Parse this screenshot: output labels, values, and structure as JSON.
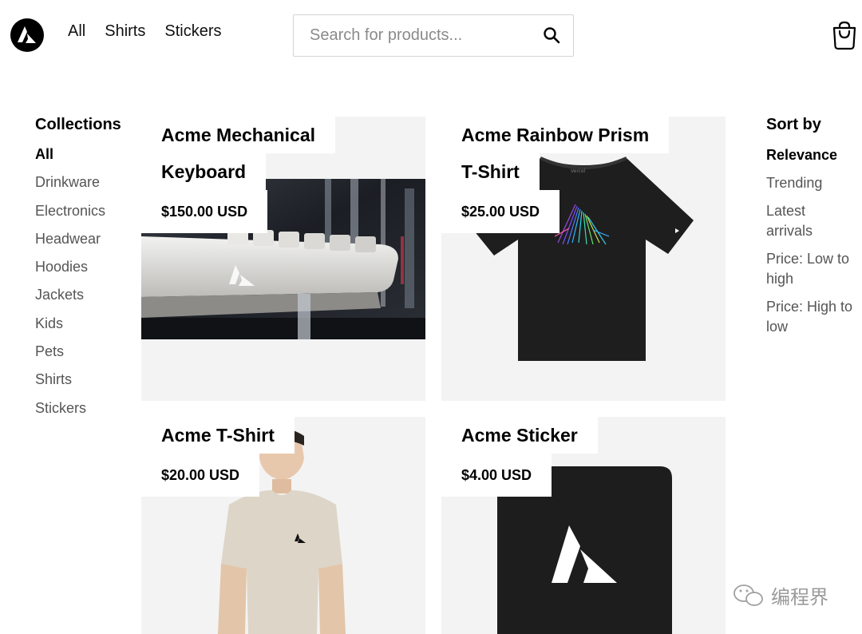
{
  "header": {
    "nav": [
      "All",
      "Shirts",
      "Stickers"
    ],
    "search_placeholder": "Search for products..."
  },
  "collections": {
    "title": "Collections",
    "items": [
      "All",
      "Drinkware",
      "Electronics",
      "Headwear",
      "Hoodies",
      "Jackets",
      "Kids",
      "Pets",
      "Shirts",
      "Stickers"
    ],
    "active": "All"
  },
  "sort": {
    "title": "Sort by",
    "items": [
      "Relevance",
      "Trending",
      "Latest arrivals",
      "Price: Low to high",
      "Price: High to low"
    ],
    "active": "Relevance"
  },
  "products": [
    {
      "title_line1": "Acme Mechanical",
      "title_line2": "Keyboard",
      "price": "$150.00 USD"
    },
    {
      "title_line1": "Acme Rainbow Prism",
      "title_line2": "T-Shirt",
      "price": "$25.00 USD"
    },
    {
      "title_line1": "Acme T-Shirt",
      "price": "$20.00 USD"
    },
    {
      "title_line1": "Acme Sticker",
      "price": "$4.00 USD"
    }
  ],
  "watermark": {
    "text": "编程界"
  },
  "colors": {
    "accent": "#000000",
    "muted": "#555555",
    "card_bg": "#f3f3f3"
  }
}
